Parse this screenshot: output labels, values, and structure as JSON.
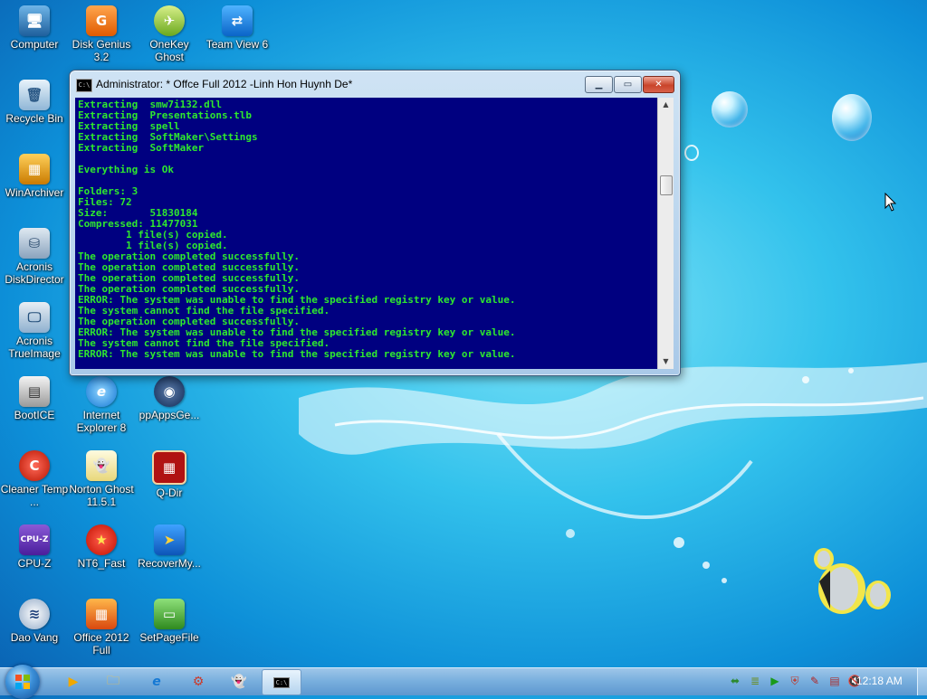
{
  "desktop": {
    "icons": [
      {
        "label": "Computer"
      },
      {
        "label": "Disk Genius 3.2"
      },
      {
        "label": "OneKey Ghost"
      },
      {
        "label": "Team View 6"
      },
      {
        "label": "Recycle Bin"
      },
      {
        "label": "WinArchiver"
      },
      {
        "label": "Acronis DiskDirector"
      },
      {
        "label": "Acronis TrueImage"
      },
      {
        "label": "BootICE"
      },
      {
        "label": "Internet Explorer 8"
      },
      {
        "label": "ppAppsGe..."
      },
      {
        "label": "Cleaner Temp ..."
      },
      {
        "label": "Norton Ghost 11.5.1"
      },
      {
        "label": "Q-Dir"
      },
      {
        "label": "CPU-Z"
      },
      {
        "label": "NT6_Fast"
      },
      {
        "label": "RecoverMy..."
      },
      {
        "label": "Dao Vang"
      },
      {
        "label": "Office 2012 Full"
      },
      {
        "label": "SetPageFile"
      }
    ]
  },
  "console_window": {
    "title": "Administrator:  * Offce Full 2012 -Linh Hon Huynh De*",
    "icon_text": "C:\\",
    "output": "Extracting  smw7i132.dll\nExtracting  Presentations.tlb\nExtracting  spell\nExtracting  SoftMaker\\Settings\nExtracting  SoftMaker\n\nEverything is Ok\n\nFolders: 3\nFiles: 72\nSize:       51830184\nCompressed: 11477031\n        1 file(s) copied.\n        1 file(s) copied.\nThe operation completed successfully.\nThe operation completed successfully.\nThe operation completed successfully.\nThe operation completed successfully.\nERROR: The system was unable to find the specified registry key or value.\nThe system cannot find the file specified.\nThe operation completed successfully.\nERROR: The system was unable to find the specified registry key or value.\nThe system cannot find the file specified.\nERROR: The system was unable to find the specified registry key or value.\n_"
  },
  "taskbar": {
    "clock": "12:18 AM"
  },
  "colors": {
    "console_bg": "#000080",
    "console_text": "#2ee82e",
    "close_button": "#c9442a"
  }
}
